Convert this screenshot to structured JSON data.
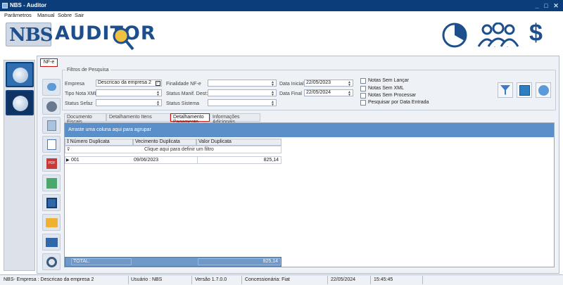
{
  "window": {
    "title": "NBS - Auditor",
    "minimize": "_",
    "maximize": "□",
    "close": "✕"
  },
  "menu": [
    "Parâmetros",
    "Manual",
    "Sobre",
    "Sair"
  ],
  "logo": {
    "brand": "NBS",
    "product": "AUDITOR"
  },
  "tabs": {
    "main": "NF-e"
  },
  "filters": {
    "legend": "Filtros de Pesquisa",
    "empresa_label": "Empresa",
    "empresa_value": "Descricao da empresa 2",
    "tipo_nota_label": "Tipo Nota XML",
    "status_sefaz_label": "Status Sefaz",
    "finalidade_label": "Finalidade NF-e",
    "status_manif_label": "Status Manif. Dest:",
    "status_sistema_label": "Status Sistema",
    "data_inicial_label": "Data Inicial",
    "data_inicial_value": "22/05/2023",
    "data_final_label": "Data Final",
    "data_final_value": "22/05/2024",
    "checks": [
      "Notas Sem Lançar",
      "Notas Sem XML",
      "Notas Sem Processar",
      "Pesquisar por Data Entrada"
    ]
  },
  "subtabs": [
    "Documento Fiscais",
    "Detalhamento Itens",
    "Detalhamento Pagamento",
    "Informações Adicionais"
  ],
  "grid": {
    "group_hint": "Arraste uma coluna aqui para agrupar",
    "filter_hint": "Clique aqui para definir um filtro",
    "columns": [
      "Número Duplicata",
      "Vecimento Duplicata",
      "Valor Duplicata"
    ],
    "rows": [
      {
        "numero": "001",
        "vencimento": "09/06/2023",
        "valor": "825,14"
      }
    ],
    "total_label": "TOTAL:",
    "total_value": "825,14"
  },
  "status": {
    "empresa": "NBS- Empresa : Descricao da empresa 2",
    "usuario": "Usuário : NBS",
    "versao": "Versão 1.7.0.0",
    "concessionaria": "Concessionária: Fiat",
    "data": "22/05/2024",
    "hora": "15:45:45"
  },
  "colors": {
    "titlebar": "#0b3d7a",
    "groupbar": "#5b8fc9",
    "active_tab_border": "#d01010",
    "logo_blue": "#1d4f8c"
  },
  "icons": [
    "pie-chart-icon",
    "users-icon",
    "dollar-icon",
    "nfe-leaf-icon",
    "filter-icon",
    "excel-icon",
    "log-icon",
    "pdf-icon",
    "save-icon",
    "folder-icon",
    "email-icon",
    "settings-icon"
  ]
}
